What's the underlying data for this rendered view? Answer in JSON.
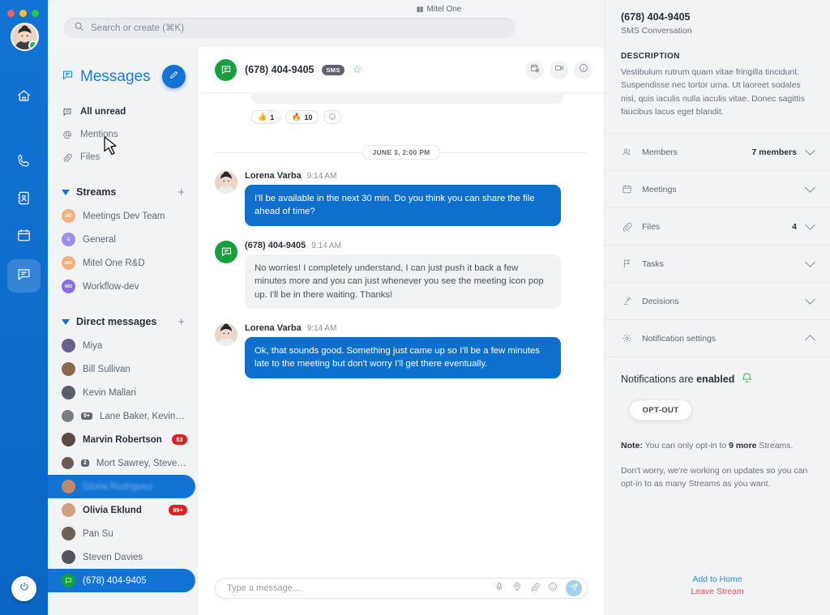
{
  "window": {
    "title": "Mitel One",
    "title_icon": "mitel-logo-icon"
  },
  "search": {
    "placeholder": "Search or create (⌘K)",
    "value": "",
    "icon": "search-icon"
  },
  "screenshare": {
    "icon": "screen-share-icon"
  },
  "rail": {
    "traffic_lights": [
      "#ff5f57",
      "#febc2e",
      "#28c840"
    ],
    "items": [
      {
        "name": "home",
        "icon": "home-icon",
        "active": false
      },
      {
        "name": "calls",
        "icon": "phone-icon",
        "active": false
      },
      {
        "name": "contacts",
        "icon": "contacts-book-icon",
        "active": false
      },
      {
        "name": "meetings",
        "icon": "calendar-icon",
        "active": false
      },
      {
        "name": "messages",
        "icon": "chat-bubble-icon",
        "active": true
      }
    ],
    "power": {
      "icon": "power-icon"
    },
    "presence": "available"
  },
  "sidebar": {
    "header": {
      "title": "Messages",
      "icon": "chat-bubble-icon",
      "compose_icon": "compose-pencil-icon"
    },
    "nav": [
      {
        "label": "All unread",
        "icon": "unread-chat-icon",
        "bold": true
      },
      {
        "label": "Mentions",
        "icon": "at-sign-icon",
        "bold": false
      },
      {
        "label": "Files",
        "icon": "paperclip-icon",
        "bold": false
      }
    ],
    "streams": {
      "title": "Streams",
      "add_label": "+",
      "items": [
        {
          "label": "Meetings Dev Team",
          "initials": "MD",
          "color": "#f2b07a"
        },
        {
          "label": "General",
          "initials": "G",
          "color": "#9b8cf0"
        },
        {
          "label": "Mitel One R&D",
          "initials": "MO",
          "color": "#f2b07a"
        },
        {
          "label": "Workflow-dev",
          "initials": "WD",
          "color": "#8b6ce8"
        }
      ]
    },
    "direct_messages": {
      "title": "Direct messages",
      "add_label": "+",
      "items": [
        {
          "label": "Miya",
          "bold": false,
          "badge": "",
          "type": "person",
          "avatar": "#6a5f8a"
        },
        {
          "label": "Bill Sullivan",
          "bold": false,
          "badge": "",
          "type": "person",
          "avatar": "#8a6a4a"
        },
        {
          "label": "Kevin Mallari",
          "bold": false,
          "badge": "",
          "type": "person",
          "avatar": "#595f66"
        },
        {
          "label": "Lane Baker, Kevin Mall...",
          "bold": false,
          "badge": "",
          "type": "group",
          "group_count": "9+",
          "avatar": "#7a7f86"
        },
        {
          "label": "Marvin Robertson",
          "bold": true,
          "badge": "53",
          "type": "person",
          "avatar": "#5a4a42"
        },
        {
          "label": "Mort Sawrey, Steve Smith",
          "bold": false,
          "badge": "",
          "type": "group",
          "group_count": "2",
          "avatar": "#6a5a52"
        },
        {
          "label": "Gloria Rodriguez",
          "bold": false,
          "badge": "",
          "type": "person",
          "selected": true,
          "blurred": true,
          "avatar": "#c08a6a"
        },
        {
          "label": "Olivia Eklund",
          "bold": true,
          "badge": "99+",
          "type": "person",
          "avatar": "#d0a080"
        },
        {
          "label": "Pan Su",
          "bold": false,
          "badge": "",
          "type": "person",
          "avatar": "#6b6156"
        },
        {
          "label": "Steven Davies",
          "bold": false,
          "badge": "",
          "type": "person",
          "avatar": "#4f5660"
        },
        {
          "label": "(678) 404-9405",
          "bold": false,
          "badge": "",
          "type": "sms",
          "selected": true,
          "avatar": "#15a03c"
        }
      ]
    }
  },
  "chat": {
    "header": {
      "title": "(678) 404-9405",
      "tag": "SMS",
      "star_icon": "star-outline-icon",
      "avatar_icon": "sms-chat-icon",
      "actions": [
        {
          "name": "schedule-meeting",
          "icon": "calendar-add-icon"
        },
        {
          "name": "video-call",
          "icon": "video-camera-icon"
        },
        {
          "name": "info",
          "icon": "info-circle-icon"
        }
      ]
    },
    "reactions": [
      {
        "emoji": "👍",
        "count": "1",
        "name": "thumbs-up"
      },
      {
        "emoji": "🔥",
        "count": "10",
        "name": "fire"
      }
    ],
    "add_reaction_icon": "add-reaction-icon",
    "date_separator": "JUNE 3, 2:00 PM",
    "messages": [
      {
        "sender": "Lorena Varba",
        "time": "9:14 AM",
        "text": "I'll be available in the next 30 min. Do you think you can share the file ahead of time?",
        "direction": "out",
        "avatar_type": "photo"
      },
      {
        "sender": "(678) 404-9405",
        "time": "9:14 AM",
        "text": "No worries! I completely understand, I can just push it back a few minutes more and you can just whenever you see the meeting icon pop up. I'll be in there waiting. Thanks!",
        "direction": "in",
        "avatar_type": "sms"
      },
      {
        "sender": "Lorena Varba",
        "time": "9:14 AM",
        "text": "Ok, that sounds good. Something just came up so I'll be a few minutes late to the meeting but don't worry I'll get there eventually.",
        "direction": "out",
        "avatar_type": "photo"
      }
    ],
    "composer": {
      "placeholder": "Type a message...",
      "value": "",
      "icons": [
        {
          "name": "microphone-icon"
        },
        {
          "name": "location-pin-icon"
        },
        {
          "name": "paperclip-icon"
        },
        {
          "name": "emoji-smiley-icon"
        }
      ],
      "send_icon": "send-paper-plane-icon"
    }
  },
  "info_panel": {
    "title": "(678) 404-9405",
    "subtitle": "SMS Conversation",
    "description_label": "DESCRIPTION",
    "description": "Vestibulum rutrum quam vitae fringilla tincidunt. Suspendisse nec tortor urna. Ut laoreet sodales nisi, quis iaculis nulla iaculis vitae. Donec sagittis faucibus lacus eget blandit.",
    "rows": [
      {
        "label": "Members",
        "value": "7 members",
        "icon": "people-icon",
        "expanded": false
      },
      {
        "label": "Meetings",
        "value": "",
        "icon": "calendar-icon",
        "expanded": false
      },
      {
        "label": "Files",
        "value": "4",
        "icon": "paperclip-icon",
        "expanded": false
      },
      {
        "label": "Tasks",
        "value": "",
        "icon": "flag-icon",
        "expanded": false
      },
      {
        "label": "Decisions",
        "value": "",
        "icon": "gavel-icon",
        "expanded": false
      },
      {
        "label": "Notification settings",
        "value": "",
        "icon": "gear-icon",
        "expanded": true
      }
    ],
    "notifications": {
      "state_prefix": "Notifications are ",
      "state_value": "enabled",
      "bell_icon": "bell-icon",
      "optout_label": "OPT-OUT",
      "note_label": "Note:",
      "note_text_1": " You can only opt-in to ",
      "note_count": "9 more",
      "note_text_2": " Streams.",
      "note_2": "Don't worry, we're working on updates so you can opt-in to as many Streams as you want."
    },
    "links": {
      "add_home": "Add to Home",
      "leave": "Leave Stream"
    }
  },
  "colors": {
    "brand_blue": "#1273d4",
    "bubble_out": "#0f6fcd",
    "bubble_in": "#f1f2f4",
    "sms_green": "#15a03c",
    "badge_red": "#e02020",
    "link_blue": "#2f8fe0",
    "link_red": "#e0555a"
  }
}
